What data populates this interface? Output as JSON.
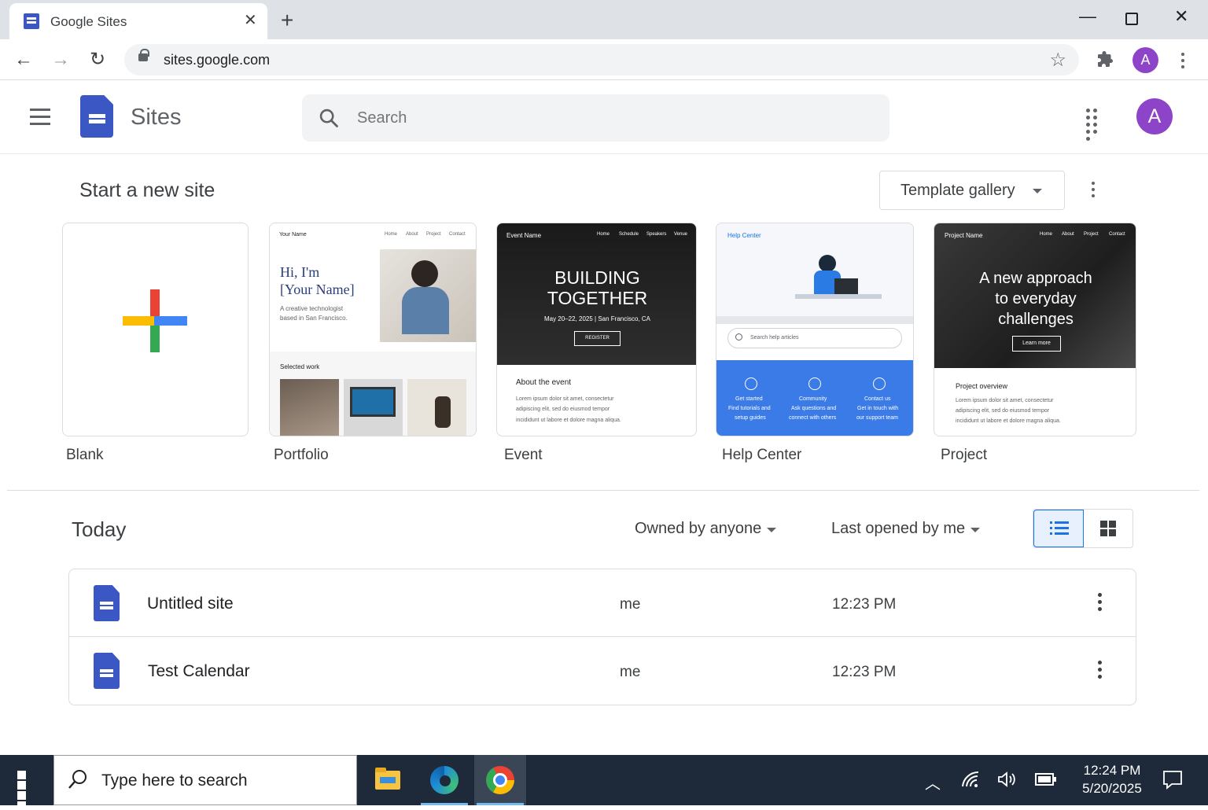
{
  "browser": {
    "tab_title": "Google Sites",
    "url": "sites.google.com",
    "profile_initial": "A"
  },
  "app": {
    "name": "Sites",
    "search_placeholder": "Search",
    "avatar_initial": "A"
  },
  "templates": {
    "heading": "Start a new site",
    "gallery_button": "Template gallery",
    "items": [
      {
        "label": "Blank"
      },
      {
        "label": "Portfolio",
        "preview": {
          "brand": "Your Name",
          "nav": [
            "Home",
            "About",
            "Project",
            "Contact"
          ],
          "headline_1": "Hi, I'm",
          "headline_2": "[Your Name]",
          "desc_1": "A creative technologist",
          "desc_2": "based in San Francisco.",
          "section": "Selected work"
        }
      },
      {
        "label": "Event",
        "preview": {
          "brand": "Event Name",
          "nav": [
            "Home",
            "Schedule",
            "Speakers",
            "Venue"
          ],
          "headline_1": "BUILDING",
          "headline_2": "TOGETHER",
          "date": "May 20–22, 2025 | San Francisco, CA",
          "cta": "REGISTER",
          "section": "About the event",
          "body_1": "Lorem ipsum dolor sit amet, consectetur",
          "body_2": "adipiscing elit, sed do eiusmod tempor",
          "body_3": "incididunt ut labore et dolore magna aliqua."
        }
      },
      {
        "label": "Help Center",
        "preview": {
          "brand": "Help Center",
          "search": "Search help articles",
          "cols": [
            {
              "t": "Get started",
              "d1": "Find tutorials and",
              "d2": "setup guides"
            },
            {
              "t": "Community",
              "d1": "Ask questions and",
              "d2": "connect with others"
            },
            {
              "t": "Contact us",
              "d1": "Get in touch with",
              "d2": "our support team"
            }
          ]
        }
      },
      {
        "label": "Project",
        "preview": {
          "brand": "Project Name",
          "nav": [
            "Home",
            "About",
            "Project",
            "Contact"
          ],
          "headline_1": "A new approach",
          "headline_2": "to everyday",
          "headline_3": "challenges",
          "cta": "Learn more",
          "section": "Project overview",
          "body_1": "Lorem ipsum dolor sit amet, consectetur",
          "body_2": "adipiscing elit, sed do eiusmod tempor",
          "body_3": "incididunt ut labore et dolore magna aliqua."
        }
      }
    ]
  },
  "recent": {
    "heading": "Today",
    "owner_filter": "Owned by anyone",
    "sort_filter": "Last opened by me",
    "view": "list",
    "rows": [
      {
        "name": "Untitled site",
        "owner": "me",
        "time": "12:23 PM"
      },
      {
        "name": "Test Calendar",
        "owner": "me",
        "time": "12:23 PM"
      }
    ]
  },
  "taskbar": {
    "search_placeholder": "Type here to search",
    "time": "12:24 PM",
    "date": "5/20/2025",
    "apps": [
      "file-explorer-icon",
      "edge-icon",
      "chrome-icon"
    ]
  },
  "colors": {
    "accent": "#1a73e8",
    "sites_blue": "#3b57c4",
    "avatar": "#8e44c8"
  }
}
